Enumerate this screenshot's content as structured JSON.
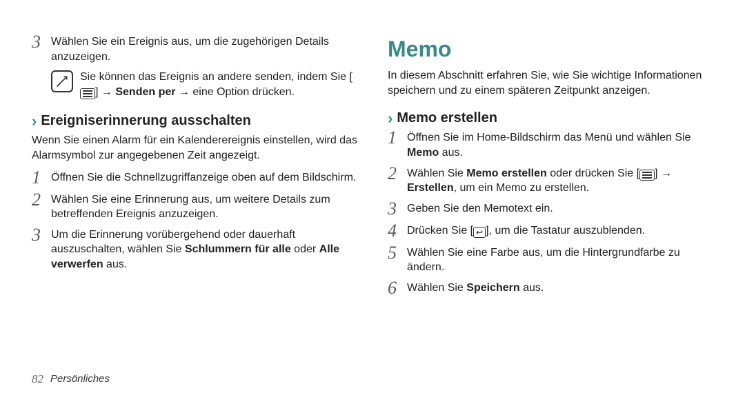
{
  "left": {
    "step3": "Wählen Sie ein Ereignis aus, um die zugehörigen Details anzuzeigen.",
    "note_pre": "Sie können das Ereignis an andere senden, indem Sie [",
    "note_mid1": "] → ",
    "note_bold": "Senden per",
    "note_mid2": " → eine Option drücken.",
    "sub_h": "Ereigniserinnerung ausschalten",
    "intro": "Wenn Sie einen Alarm für ein Kalenderereignis einstellen, wird das Alarmsymbol zur angegebenen Zeit angezeigt.",
    "s1": "Öffnen Sie die Schnellzugriffanzeige oben auf dem Bildschirm.",
    "s2": "Wählen Sie eine Erinnerung aus, um weitere Details zum betreffenden Ereignis anzuzeigen.",
    "s3_a": "Um die Erinnerung vorübergehend oder dauerhaft auszuschalten, wählen Sie ",
    "s3_b1": "Schlummern für alle",
    "s3_mid": " oder ",
    "s3_b2": "Alle verwerfen",
    "s3_end": " aus."
  },
  "right": {
    "h1": "Memo",
    "intro": "In diesem Abschnitt erfahren Sie, wie Sie wichtige Informationen speichern und zu einem späteren Zeitpunkt anzeigen.",
    "sub_h": "Memo erstellen",
    "s1_a": "Öffnen Sie im Home-Bildschirm das Menü und wählen Sie ",
    "s1_b": "Memo",
    "s1_c": " aus.",
    "s2_a": "Wählen Sie ",
    "s2_b": "Memo erstellen",
    "s2_c": " oder drücken Sie [",
    "s2_d": "] → ",
    "s2_e": "Erstellen",
    "s2_f": ", um ein Memo zu erstellen.",
    "s3": "Geben Sie den Memotext ein.",
    "s4_a": "Drücken Sie [",
    "s4_b": "], um die Tastatur auszublenden.",
    "s5": "Wählen Sie eine Farbe aus, um die Hintergrundfarbe zu ändern.",
    "s6_a": "Wählen Sie ",
    "s6_b": "Speichern",
    "s6_c": " aus."
  },
  "footer": {
    "page": "82",
    "section": "Persönliches"
  }
}
